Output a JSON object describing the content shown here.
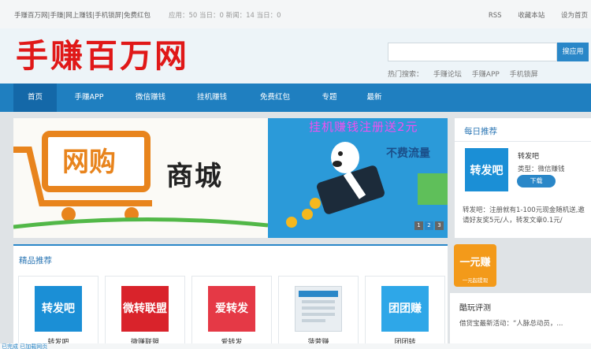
{
  "topbar": {
    "site_links": "手赚百万网|手赚|网上赚钱|手机锁屏|免费红包",
    "stats": "应用：50 当日：0 新闻：14 当日：0",
    "links": [
      "RSS",
      "收藏本站",
      "设为首页"
    ]
  },
  "header": {
    "logo": "手赚百万网",
    "search_button": "搜应用",
    "hot_label": "热门搜索：",
    "hot_items": [
      "手赚论坛",
      "手赚APP",
      "手机锁屏"
    ]
  },
  "nav": {
    "items": [
      "首页",
      "手赚APP",
      "微信赚钱",
      "挂机赚钱",
      "免费红包",
      "专题",
      "最新"
    ]
  },
  "banner": {
    "left_big": "网购",
    "left_text": "商城",
    "right_title": "挂机赚钱注册送2元",
    "right_sub": "不费流量",
    "dots": [
      "1",
      "2",
      "3"
    ]
  },
  "daily": {
    "title": "每日推荐",
    "tile_text": "转发吧",
    "name": "转发吧",
    "type": "类型：微信赚钱",
    "download": "下载",
    "desc": "转发吧：注册就有1-100元现金随机送,邀请好友奖5元/人，转发文章0.1元/"
  },
  "featured": {
    "title": "精品推荐",
    "cards": [
      {
        "img_text": "转发吧",
        "label": "转发吧",
        "color": "#1b8fd6"
      },
      {
        "img_text": "微转联盟",
        "label": "微赚联盟",
        "color": "#d9232b"
      },
      {
        "img_text": "爱转发",
        "label": "爱转发",
        "color": "#e53946"
      },
      {
        "img_text": "",
        "label": "菠萝赚",
        "color": "#e9eef2"
      },
      {
        "img_text": "团团赚",
        "label": "团团转",
        "color": "#2ea7e8"
      }
    ]
  },
  "promo": {
    "title": "一元赚",
    "sub": "一元起提现"
  },
  "reviews": {
    "title": "酷玩评测",
    "item": "借贷宝最新活动：“人脉总动员，..."
  },
  "status": {
    "text": "已完成 已加载网页"
  }
}
